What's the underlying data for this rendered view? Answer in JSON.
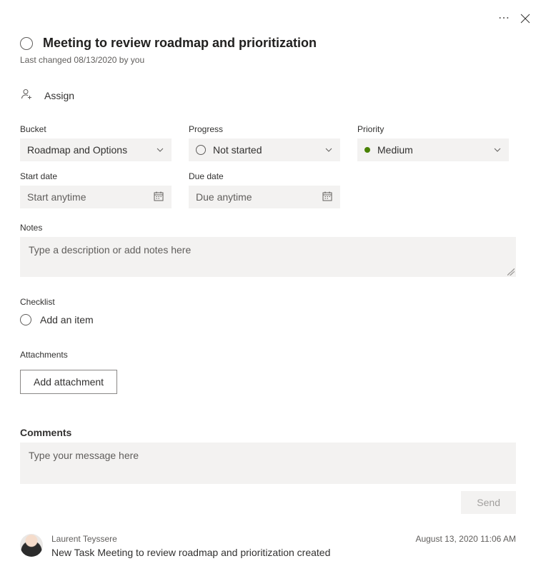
{
  "header": {
    "title": "Meeting to review roadmap and prioritization",
    "last_changed": "Last changed 08/13/2020 by you"
  },
  "assign": {
    "label": "Assign"
  },
  "fields": {
    "bucket": {
      "label": "Bucket",
      "value": "Roadmap and Options"
    },
    "progress": {
      "label": "Progress",
      "value": "Not started"
    },
    "priority": {
      "label": "Priority",
      "value": "Medium",
      "color": "#498205"
    },
    "start_date": {
      "label": "Start date",
      "placeholder": "Start anytime"
    },
    "due_date": {
      "label": "Due date",
      "placeholder": "Due anytime"
    }
  },
  "notes": {
    "label": "Notes",
    "placeholder": "Type a description or add notes here"
  },
  "checklist": {
    "label": "Checklist",
    "add_placeholder": "Add an item"
  },
  "attachments": {
    "label": "Attachments",
    "add_button": "Add attachment"
  },
  "comments": {
    "heading": "Comments",
    "input_placeholder": "Type your message here",
    "send_label": "Send"
  },
  "activity": [
    {
      "author": "Laurent Teyssere",
      "timestamp": "August 13, 2020 11:06 AM",
      "text": "New Task Meeting to review roadmap and prioritization created"
    }
  ]
}
